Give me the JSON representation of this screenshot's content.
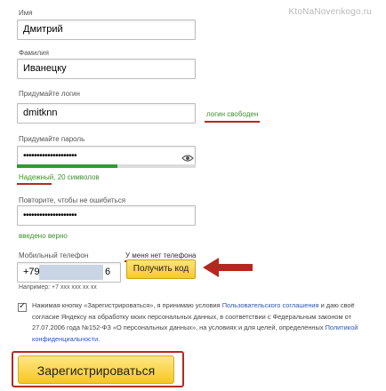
{
  "watermark": "KtoNaNovenkogo.ru",
  "first_name": {
    "label": "Имя",
    "value": "Дмитрий"
  },
  "last_name": {
    "label": "Фамилия",
    "value": "Иванецку"
  },
  "login": {
    "label": "Придумайте логин",
    "value": "dmitknn",
    "status": "логин свободен"
  },
  "password": {
    "label": "Придумайте пароль",
    "value": "••••••••••••••••••••",
    "strength_text": "Надежный, 20 символов",
    "strength_fraction": 0.56,
    "icon": "eye-icon"
  },
  "password_repeat": {
    "label": "Повторите, чтобы не ошибиться",
    "value": "••••••••••••••••••••",
    "status": "введено верно"
  },
  "phone": {
    "label": "Мобильный телефон",
    "value_prefix": "+79",
    "value_suffix": "6",
    "no_phone_link": "У меня нет телефона",
    "get_code_label": "Получить код",
    "example": "Например: +7 xxx xxx xx xx"
  },
  "agreement": {
    "checked": true,
    "part1": "Нажимая кнопку «Зарегистрироваться», я принимаю условия ",
    "link1": "Пользовательского соглашения",
    "part2": " и даю своё согласие Яндексу на обработку моих персональных данных, в соответствии с Федеральным законом от 27.07.2006 года №152-ФЗ «О персональных данных», на условиях и для целей, определенных ",
    "link2": "Политикой конфиденциальности",
    "part3": "."
  },
  "submit_label": "Зарегистрироваться",
  "colors": {
    "accent_yellow": "#f8c929",
    "annotation_red": "#b22a1f",
    "success_green": "#3e8f2d",
    "link_blue": "#2a57b6"
  }
}
